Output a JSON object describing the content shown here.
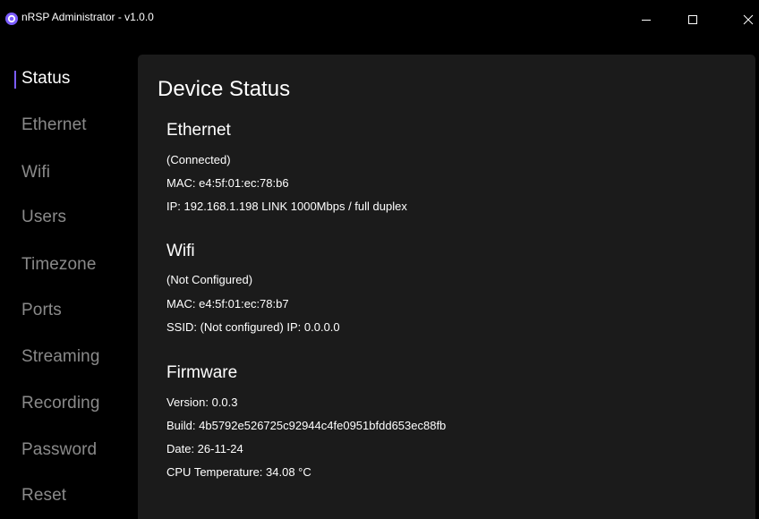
{
  "window": {
    "title": "nRSP Administrator - v1.0.0",
    "accent_color": "#7b5cff",
    "background_color": "#000000",
    "panel_color": "#1b1b1b",
    "icons": {
      "app": "app-logo-icon",
      "minimize": "minimize-icon",
      "maximize": "maximize-icon",
      "close": "close-icon"
    }
  },
  "sidebar": {
    "active": "Status",
    "items": [
      {
        "label": "Status"
      },
      {
        "label": "Ethernet"
      },
      {
        "label": "Wifi"
      },
      {
        "label": "Users"
      },
      {
        "label": "Timezone"
      },
      {
        "label": "Ports"
      },
      {
        "label": "Streaming"
      },
      {
        "label": "Recording"
      },
      {
        "label": "Password"
      },
      {
        "label": "Reset"
      }
    ]
  },
  "main": {
    "title": "Device Status",
    "ethernet": {
      "heading": "Ethernet",
      "status": "(Connected)",
      "mac": "MAC: e4:5f:01:ec:78:b6",
      "ip": "IP: 192.168.1.198 LINK 1000Mbps / full duplex"
    },
    "wifi": {
      "heading": "Wifi",
      "status": "(Not Configured)",
      "mac": "MAC: e4:5f:01:ec:78:b7",
      "ssid": "SSID: (Not configured) IP: 0.0.0.0"
    },
    "firmware": {
      "heading": "Firmware",
      "version": "Version: 0.0.3",
      "build": "Build: 4b5792e526725c92944c4fe0951bfdd653ec88fb",
      "date": "Date: 26-11-24",
      "cpu_temp": "CPU Temperature: 34.08 °C"
    }
  }
}
